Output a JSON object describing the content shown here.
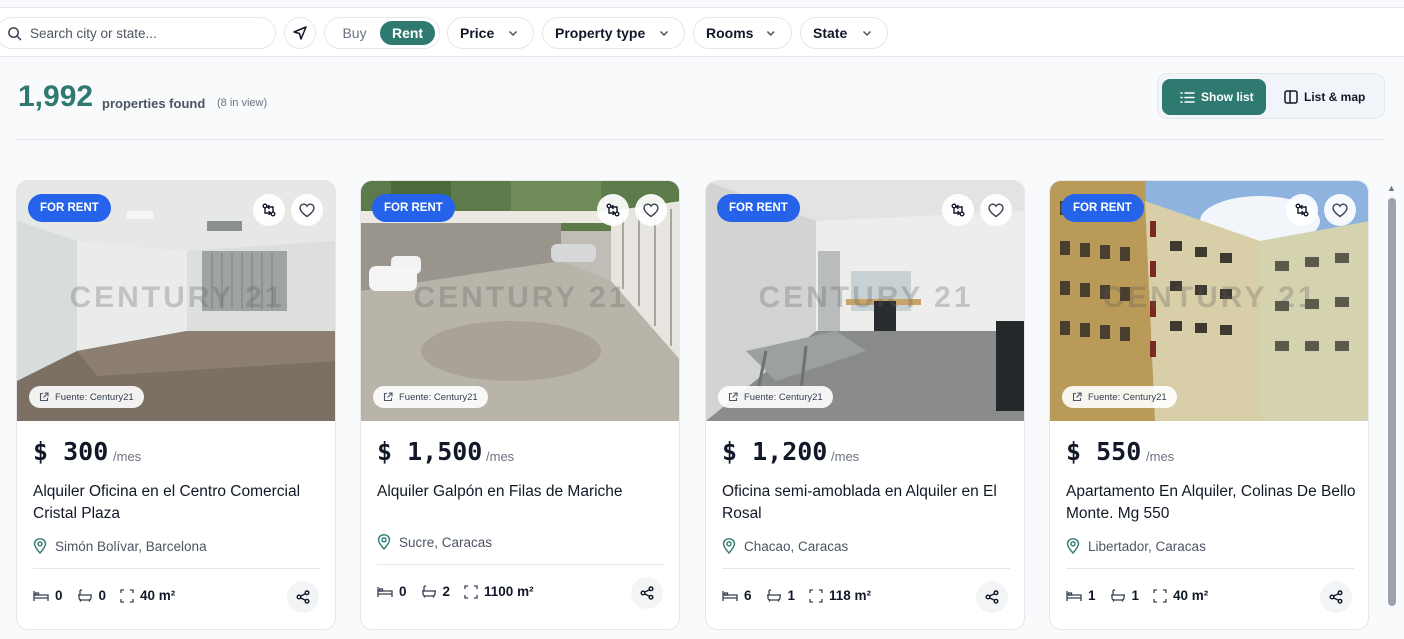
{
  "search": {
    "placeholder": "Search city or state..."
  },
  "mode": {
    "buy": "Buy",
    "rent": "Rent"
  },
  "filters": [
    "Price",
    "Property type",
    "Rooms",
    "State"
  ],
  "results": {
    "count": "1,992",
    "label": "properties found",
    "in_view": "(8 in view)"
  },
  "view_toggle": {
    "list": "Show list",
    "list_map": "List & map"
  },
  "colors": {
    "accent": "#2f7a70",
    "badge": "#2563eb"
  },
  "cards": [
    {
      "badge": "FOR RENT",
      "watermark": "CENTURY 21",
      "source": "Fuente: Century21",
      "price": "$ 300",
      "per": "/mes",
      "title": "Alquiler Oficina en el Centro Comercial Cristal Plaza",
      "location": "Simón Bolívar, Barcelona",
      "beds": "0",
      "baths": "0",
      "area": "40 m²"
    },
    {
      "badge": "FOR RENT",
      "watermark": "CENTURY 21",
      "source": "Fuente: Century21",
      "price": "$ 1,500",
      "per": "/mes",
      "title": "Alquiler Galpón en Filas de Mariche",
      "location": "Sucre, Caracas",
      "beds": "0",
      "baths": "2",
      "area": "1100 m²"
    },
    {
      "badge": "FOR RENT",
      "watermark": "CENTURY 21",
      "source": "Fuente: Century21",
      "price": "$ 1,200",
      "per": "/mes",
      "title": "Oficina semi-amoblada en Alquiler en El Rosal",
      "location": "Chacao, Caracas",
      "beds": "6",
      "baths": "1",
      "area": "118 m²"
    },
    {
      "badge": "FOR RENT",
      "watermark": "CENTURY 21",
      "source": "Fuente: Century21",
      "price": "$ 550",
      "per": "/mes",
      "title": "Apartamento En Alquiler, Colinas De Bello Monte. Mg 550",
      "location": "Libertador, Caracas",
      "beds": "1",
      "baths": "1",
      "area": "40 m²"
    }
  ]
}
